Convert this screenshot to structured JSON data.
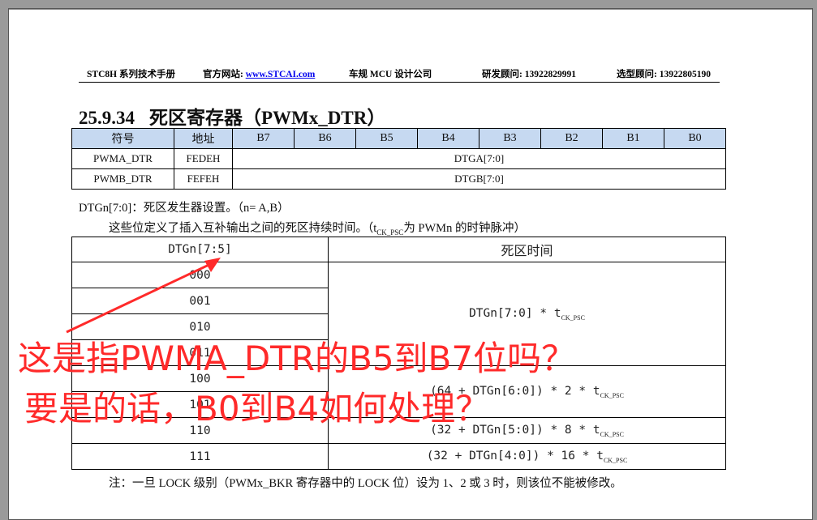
{
  "header": {
    "manual": "STC8H 系列技术手册",
    "website_label": "官方网站: ",
    "website_link": "www.STCAI.com",
    "company": "车规 MCU 设计公司",
    "rd_consultant": "研发顾问: 13922829991",
    "selection_consultant": "选型顾问: 13922805190"
  },
  "section": {
    "number": "25.9.34",
    "title": "死区寄存器（PWMx_DTR）"
  },
  "register_table": {
    "headers": [
      "符号",
      "地址",
      "B7",
      "B6",
      "B5",
      "B4",
      "B3",
      "B2",
      "B1",
      "B0"
    ],
    "rows": [
      {
        "symbol": "PWMA_DTR",
        "address": "FEDEH",
        "field": "DTGA[7:0]"
      },
      {
        "symbol": "PWMB_DTR",
        "address": "FEFEH",
        "field": "DTGB[7:0]"
      }
    ]
  },
  "description": {
    "line1": "DTGn[7:0]：死区发生器设置。（n= A,B）",
    "line2_pre": "这些位定义了插入互补输出之间的死区持续时间。（t",
    "line2_sub": "CK_PSC",
    "line2_post": "为 PWMn 的时钟脉冲）"
  },
  "deadtime_table": {
    "header_code": "DTGn[7:5]",
    "header_time": "死区时间",
    "codes": [
      "000",
      "001",
      "010",
      "011",
      "100",
      "101",
      "110",
      "111"
    ],
    "formulas": [
      {
        "expr": "DTGn[7:0] * t",
        "sub": "CK_PSC"
      },
      {
        "expr": "(64 + DTGn[6:0]) * 2 * t",
        "sub": "CK_PSC"
      },
      {
        "expr": "(32 + DTGn[5:0]) * 8 * t",
        "sub": "CK_PSC"
      },
      {
        "expr": "(32 + DTGn[4:0]) * 16 * t",
        "sub": "CK_PSC"
      }
    ]
  },
  "note": "注：一旦 LOCK 级别（PWMx_BKR 寄存器中的 LOCK 位）设为 1、2 或 3 时，则该位不能被修改。",
  "annotation": {
    "line1": "这是指PWMA_DTR的B5到B7位吗？",
    "line2": "要是的话，B0到B4如何处理？",
    "color": "#ff2a2a"
  }
}
